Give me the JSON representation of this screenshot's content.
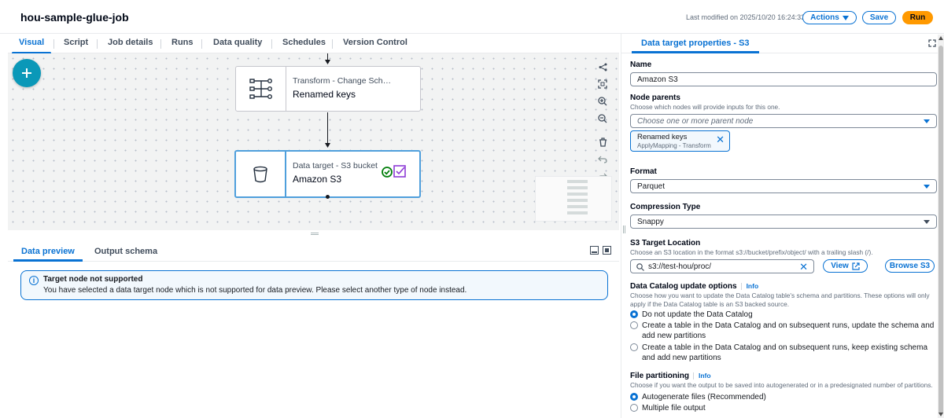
{
  "header": {
    "job_title": "hou-sample-glue-job",
    "last_modified": "Last modified on 2025/10/20 16:24:33",
    "actions_label": "Actions",
    "save_label": "Save",
    "run_label": "Run"
  },
  "tabs": [
    "Visual",
    "Script",
    "Job details",
    "Runs",
    "Data quality",
    "Schedules",
    "Version Control"
  ],
  "canvas": {
    "nodes": [
      {
        "subtitle": "Transform - Change Sch…",
        "title": "Renamed keys",
        "icon": "apply-mapping-icon"
      },
      {
        "subtitle": "Data target - S3 bucket",
        "title": "Amazon S3",
        "icon": "s3-bucket-icon"
      }
    ]
  },
  "bottom_panel": {
    "tabs": [
      "Data preview",
      "Output schema"
    ],
    "alert_title": "Target node not supported",
    "alert_body": "You have selected a data target node which is not supported for data preview. Please select another type of node instead."
  },
  "right_panel": {
    "tab_label": "Data target properties - S3",
    "name_label": "Name",
    "name_value": "Amazon S3",
    "node_parents_label": "Node parents",
    "node_parents_desc": "Choose which nodes will provide inputs for this one.",
    "node_parents_placeholder": "Choose one or more parent node",
    "token_name": "Renamed keys",
    "token_sub": "ApplyMapping - Transform",
    "format_label": "Format",
    "format_value": "Parquet",
    "compression_label": "Compression Type",
    "compression_value": "Snappy",
    "s3_location_label": "S3 Target Location",
    "s3_location_desc": "Choose an S3 location in the format s3://bucket/prefix/object/ with a trailing slash (/).",
    "s3_location_value": "s3://test-hou/proc/",
    "view_label": "View",
    "browse_label": "Browse S3",
    "catalog_label": "Data Catalog update options",
    "info_label": "Info",
    "catalog_desc": "Choose how you want to update the Data Catalog table's schema and partitions. These options will only apply if the Data Catalog table is an S3 backed source.",
    "catalog_options": [
      "Do not update the Data Catalog",
      "Create a table in the Data Catalog and on subsequent runs, update the schema and add new partitions",
      "Create a table in the Data Catalog and on subsequent runs, keep existing schema and add new partitions"
    ],
    "partition_label": "File partitioning",
    "partition_desc": "Choose if you want the output to be saved into autogenerated or in a predesignated number of partitions.",
    "partition_options": [
      "Autogenerate files (Recommended)",
      "Multiple file output"
    ]
  },
  "colors": {
    "accent": "#0972d3",
    "run": "#ff9900",
    "add_button": "#0a98b8",
    "success": "#037f0c",
    "purple": "#8e3bd6"
  }
}
